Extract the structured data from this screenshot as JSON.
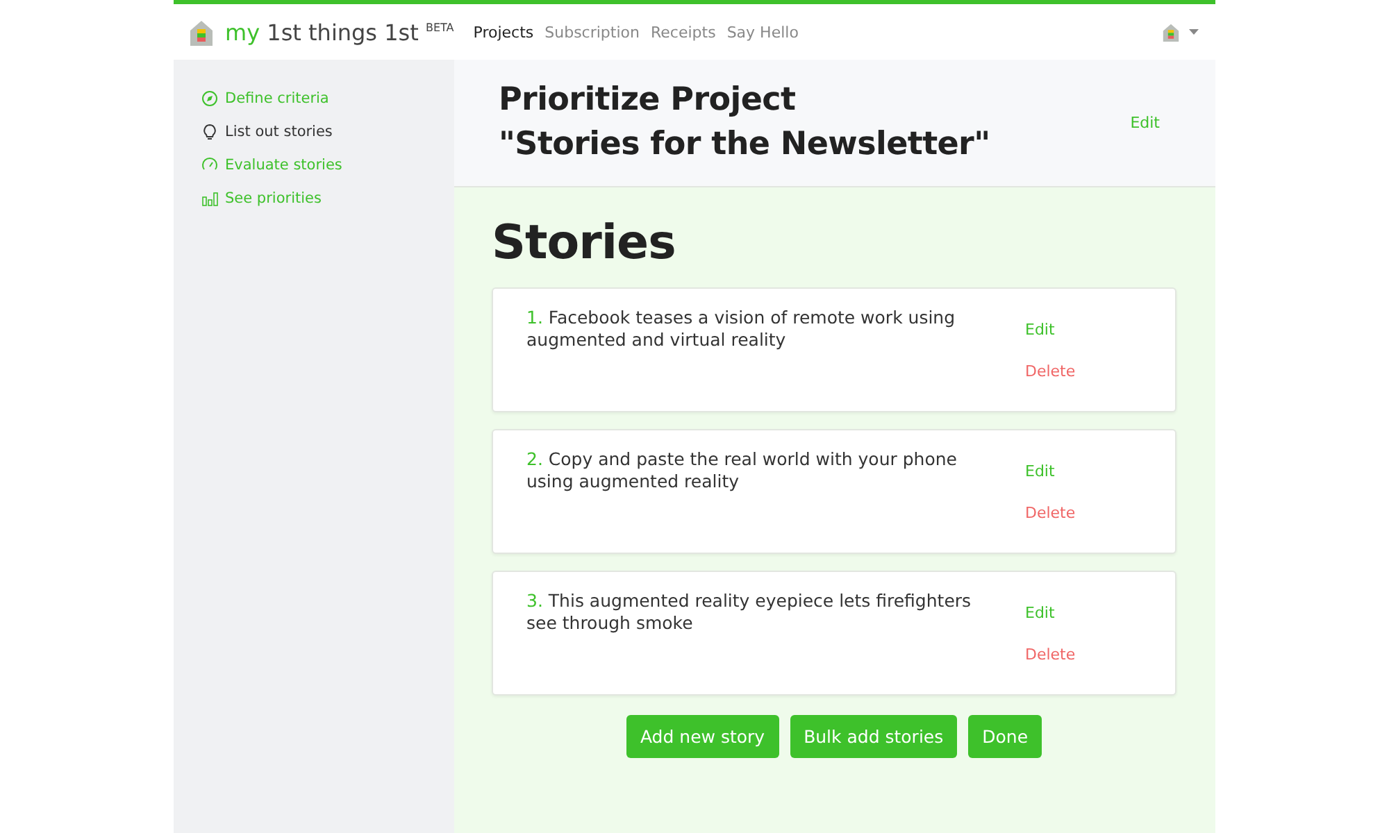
{
  "brand": {
    "accent": "my",
    "name": "1st things 1st",
    "badge": "BETA"
  },
  "nav": [
    {
      "label": "Projects",
      "selected": true
    },
    {
      "label": "Subscription",
      "selected": false
    },
    {
      "label": "Receipts",
      "selected": false
    },
    {
      "label": "Say Hello",
      "selected": false
    }
  ],
  "sidebar": {
    "items": [
      {
        "label": "Define criteria",
        "selected": false
      },
      {
        "label": "List out stories",
        "selected": true
      },
      {
        "label": "Evaluate stories",
        "selected": false
      },
      {
        "label": "See priorities",
        "selected": false
      }
    ]
  },
  "project": {
    "title_line_1": "Prioritize Project",
    "title_line_2": "\"Stories for the Newsletter\"",
    "edit": "Edit"
  },
  "stories_heading": "Stories",
  "stories": [
    {
      "number": "1.",
      "text": "Facebook teases a vision of remote work using augmented and virtual reality",
      "edit": "Edit",
      "delete": "Delete"
    },
    {
      "number": "2.",
      "text": "Copy and paste the real world with your phone using augmented reality",
      "edit": "Edit",
      "delete": "Delete"
    },
    {
      "number": "3.",
      "text": "This augmented reality eyepiece lets firefighters see through smoke",
      "edit": "Edit",
      "delete": "Delete"
    }
  ],
  "buttons": [
    "Add new story",
    "Bulk add stories",
    "Done"
  ]
}
